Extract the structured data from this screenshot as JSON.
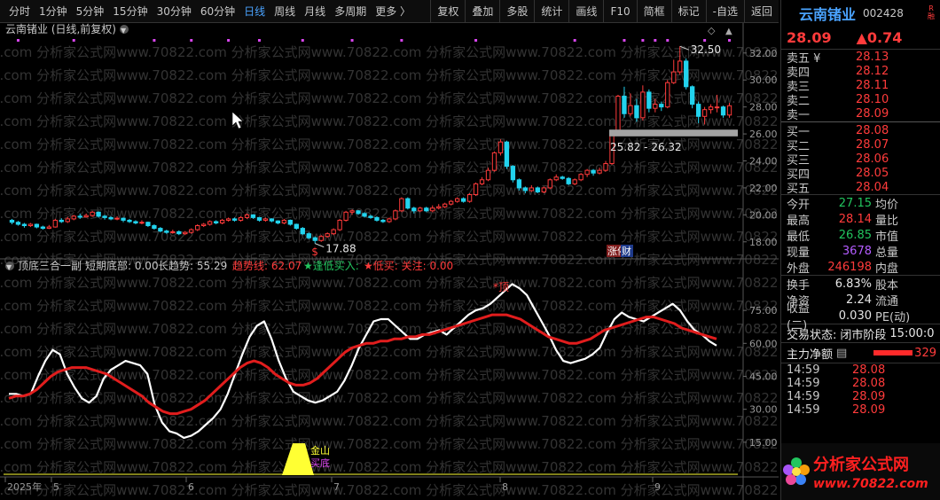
{
  "toolbar": {
    "timeframes": [
      {
        "label": "分时",
        "active": false
      },
      {
        "label": "1分钟",
        "active": false
      },
      {
        "label": "5分钟",
        "active": false
      },
      {
        "label": "15分钟",
        "active": false
      },
      {
        "label": "30分钟",
        "active": false
      },
      {
        "label": "60分钟",
        "active": false
      },
      {
        "label": "日线",
        "active": true
      },
      {
        "label": "周线",
        "active": false
      },
      {
        "label": "月线",
        "active": false
      },
      {
        "label": "多周期",
        "active": false
      },
      {
        "label": "更多 〉",
        "active": false
      }
    ],
    "tools": [
      "复权",
      "叠加",
      "多股",
      "统计",
      "画线",
      "F10",
      "简框",
      "标记",
      "-自选",
      "返回"
    ]
  },
  "main_chart": {
    "title": "云南锗业 (日线,前复权)",
    "y_ticks": [
      "32.00",
      "30.00",
      "28.00",
      "26.00",
      "24.00",
      "22.00",
      "20.00",
      "18.00"
    ],
    "labels": {
      "high": "32.50",
      "low": "17.88",
      "range": "25.82 - 26.32",
      "badge": "涨停",
      "badge2": "财",
      "dollar": "$"
    },
    "colors": {
      "up": "#ff3b3b",
      "down": "#22d3ee",
      "marker": "#d946ef",
      "band": "#a3a3a3"
    }
  },
  "chart_data": [
    {
      "type": "candlestick",
      "title": "云南锗业 (日线,前复权)",
      "ylim": [
        17,
        33.3
      ],
      "annotations": [
        {
          "text": "32.50",
          "at": "high"
        },
        {
          "text": "17.88",
          "at": "low"
        },
        {
          "text": "25.82 - 26.32",
          "at": "band"
        }
      ],
      "candles": [
        [
          19.6,
          19.45,
          19.7,
          19.3
        ],
        [
          19.45,
          19.3,
          19.55,
          19.2
        ],
        [
          19.3,
          19.2,
          19.4,
          19.05
        ],
        [
          19.2,
          19.3,
          19.4,
          19.1
        ],
        [
          19.3,
          19.1,
          19.35,
          19.0
        ],
        [
          19.1,
          19.0,
          19.2,
          18.9
        ],
        [
          19.0,
          19.1,
          19.25,
          18.95
        ],
        [
          19.1,
          19.6,
          19.7,
          19.05
        ],
        [
          19.6,
          19.5,
          19.75,
          19.4
        ],
        [
          19.5,
          19.7,
          19.85,
          19.4
        ],
        [
          19.7,
          19.9,
          20.0,
          19.6
        ],
        [
          19.9,
          19.85,
          20.1,
          19.7
        ],
        [
          19.85,
          19.95,
          20.1,
          19.8
        ],
        [
          19.95,
          20.2,
          20.3,
          19.85
        ],
        [
          20.2,
          19.9,
          20.25,
          19.8
        ],
        [
          19.9,
          19.8,
          20.0,
          19.65
        ],
        [
          19.8,
          19.7,
          19.9,
          19.6
        ],
        [
          19.7,
          19.75,
          19.9,
          19.6
        ],
        [
          19.75,
          19.6,
          19.8,
          19.45
        ],
        [
          19.6,
          19.5,
          19.7,
          19.4
        ],
        [
          19.5,
          19.4,
          19.6,
          19.3
        ],
        [
          19.4,
          19.45,
          19.6,
          19.3
        ],
        [
          19.45,
          19.2,
          19.5,
          19.1
        ],
        [
          19.2,
          19.0,
          19.3,
          18.9
        ],
        [
          19.0,
          18.8,
          19.1,
          18.7
        ],
        [
          18.8,
          18.7,
          18.9,
          18.6
        ],
        [
          18.7,
          18.75,
          18.9,
          18.6
        ],
        [
          18.75,
          18.6,
          18.85,
          18.5
        ],
        [
          18.6,
          18.7,
          18.8,
          18.5
        ],
        [
          18.7,
          18.9,
          19.0,
          18.6
        ],
        [
          18.9,
          19.2,
          19.3,
          18.8
        ],
        [
          19.2,
          19.3,
          19.4,
          19.1
        ],
        [
          19.3,
          19.5,
          19.6,
          19.2
        ],
        [
          19.5,
          19.4,
          19.6,
          19.3
        ],
        [
          19.4,
          19.6,
          19.7,
          19.3
        ],
        [
          19.6,
          19.7,
          19.8,
          19.5
        ],
        [
          19.7,
          19.6,
          19.8,
          19.5
        ],
        [
          19.6,
          19.8,
          19.9,
          19.5
        ],
        [
          19.8,
          20.0,
          20.1,
          19.7
        ],
        [
          20.0,
          19.8,
          20.05,
          19.7
        ],
        [
          19.8,
          19.6,
          19.85,
          19.5
        ],
        [
          19.6,
          19.7,
          19.8,
          19.5
        ],
        [
          19.7,
          19.55,
          19.75,
          19.45
        ],
        [
          19.55,
          19.4,
          19.6,
          19.3
        ],
        [
          19.4,
          19.6,
          19.7,
          19.3
        ],
        [
          19.6,
          19.3,
          19.65,
          19.2
        ],
        [
          19.3,
          19.0,
          19.35,
          18.9
        ],
        [
          19.0,
          18.6,
          19.1,
          18.5
        ],
        [
          18.6,
          18.3,
          18.7,
          18.2
        ],
        [
          18.3,
          18.1,
          18.4,
          17.88
        ],
        [
          18.1,
          18.4,
          18.5,
          18.0
        ],
        [
          18.4,
          18.6,
          18.7,
          18.3
        ],
        [
          18.6,
          18.9,
          19.0,
          18.5
        ],
        [
          18.9,
          19.6,
          19.7,
          18.8
        ],
        [
          19.6,
          20.2,
          20.3,
          19.5
        ],
        [
          20.2,
          20.3,
          20.4,
          20.0
        ],
        [
          20.3,
          20.1,
          20.35,
          20.0
        ],
        [
          20.1,
          19.9,
          20.2,
          19.8
        ],
        [
          19.9,
          19.8,
          20.0,
          19.7
        ],
        [
          19.8,
          19.6,
          19.9,
          19.5
        ],
        [
          19.6,
          19.5,
          19.7,
          19.4
        ],
        [
          19.5,
          19.7,
          19.8,
          19.4
        ],
        [
          19.7,
          20.3,
          20.4,
          19.6
        ],
        [
          20.3,
          21.2,
          21.3,
          20.2
        ],
        [
          21.2,
          20.5,
          21.3,
          20.4
        ],
        [
          20.5,
          20.3,
          20.6,
          20.1
        ],
        [
          20.3,
          20.5,
          20.6,
          20.2
        ],
        [
          20.5,
          20.3,
          20.6,
          20.2
        ],
        [
          20.3,
          20.5,
          20.7,
          20.2
        ],
        [
          20.5,
          20.6,
          20.8,
          20.4
        ],
        [
          20.6,
          20.8,
          20.9,
          20.5
        ],
        [
          20.8,
          21.0,
          21.1,
          20.7
        ],
        [
          21.0,
          21.2,
          21.3,
          20.9
        ],
        [
          21.2,
          21.0,
          21.3,
          20.9
        ],
        [
          21.0,
          21.5,
          21.6,
          20.9
        ],
        [
          21.5,
          22.3,
          22.4,
          21.4
        ],
        [
          22.3,
          22.6,
          22.8,
          22.2
        ],
        [
          22.6,
          23.3,
          23.5,
          22.5
        ],
        [
          23.3,
          24.6,
          24.7,
          23.2
        ],
        [
          24.6,
          25.4,
          25.6,
          24.4
        ],
        [
          25.4,
          23.6,
          25.5,
          23.4
        ],
        [
          23.6,
          22.6,
          23.7,
          22.4
        ],
        [
          22.6,
          22.0,
          22.7,
          21.8
        ],
        [
          22.0,
          21.8,
          22.1,
          21.6
        ],
        [
          21.8,
          22.0,
          22.2,
          21.7
        ],
        [
          22.0,
          21.7,
          22.1,
          21.6
        ],
        [
          21.7,
          22.0,
          22.1,
          21.6
        ],
        [
          22.0,
          22.6,
          22.7,
          21.9
        ],
        [
          22.6,
          22.8,
          23.0,
          22.5
        ],
        [
          22.8,
          22.7,
          22.9,
          22.6
        ],
        [
          22.7,
          22.3,
          22.8,
          22.2
        ],
        [
          22.3,
          22.6,
          22.7,
          22.2
        ],
        [
          22.6,
          23.0,
          23.1,
          22.5
        ],
        [
          23.0,
          23.3,
          23.4,
          22.8
        ],
        [
          23.3,
          23.1,
          23.4,
          22.9
        ],
        [
          23.1,
          23.3,
          23.5,
          23.0
        ],
        [
          23.3,
          23.8,
          24.0,
          23.2
        ],
        [
          23.8,
          26.2,
          26.3,
          23.7
        ],
        [
          26.2,
          28.8,
          28.9,
          26.2
        ],
        [
          28.8,
          27.5,
          29.5,
          27.2
        ],
        [
          27.5,
          28.1,
          29.0,
          27.3
        ],
        [
          28.1,
          27.2,
          28.6,
          26.9
        ],
        [
          27.2,
          29.1,
          29.6,
          27.0
        ],
        [
          29.1,
          27.9,
          29.3,
          27.6
        ],
        [
          27.9,
          28.2,
          28.6,
          27.6
        ],
        [
          28.2,
          28.0,
          28.4,
          27.7
        ],
        [
          28.0,
          29.8,
          30.0,
          27.9
        ],
        [
          29.8,
          30.6,
          31.5,
          29.7
        ],
        [
          30.6,
          31.4,
          32.5,
          30.4
        ],
        [
          31.4,
          29.5,
          31.6,
          29.3
        ],
        [
          29.5,
          28.2,
          29.6,
          27.9
        ],
        [
          28.2,
          27.3,
          28.4,
          26.8
        ],
        [
          27.3,
          27.8,
          28.0,
          26.7
        ],
        [
          27.8,
          28.0,
          28.2,
          27.5
        ],
        [
          28.0,
          28.0,
          28.9,
          27.6
        ],
        [
          28.0,
          27.4,
          28.1,
          27.2
        ],
        [
          27.4,
          28.09,
          28.3,
          27.2
        ]
      ]
    },
    {
      "type": "line",
      "title": "顶底三合一副",
      "ylim": [
        0,
        92
      ],
      "y_ticks": [
        "75.00",
        "60.00",
        "45.00",
        "30.00",
        "15.00"
      ],
      "x_tick_labels": [
        "2025年",
        "5",
        "6",
        "7",
        "8",
        "9"
      ],
      "legend": [
        {
          "text": "短期底部: 0.00",
          "color": "#c8c8c8"
        },
        {
          "text": "长趋势: 55.29",
          "color": "#c8c8c8"
        },
        {
          "text": "趋势线: 62.07",
          "color": "#ff3b3b"
        },
        {
          "text": "★逢低买入:",
          "color": "#22c55e"
        },
        {
          "text": "★低买: 关注: 0.00",
          "color": "#ff3b3b"
        }
      ],
      "series": [
        {
          "name": "短期底部",
          "color": "#ffffff",
          "values": [
            37,
            37,
            36,
            37,
            45,
            52,
            57,
            55,
            46,
            40,
            35,
            33,
            36,
            44,
            48,
            50,
            52,
            51,
            50,
            46,
            32,
            24,
            20,
            19,
            17,
            18,
            20,
            23,
            26,
            30,
            37,
            46,
            55,
            63,
            68,
            70,
            62,
            52,
            44,
            38,
            36,
            34,
            33,
            34,
            36,
            38,
            43,
            50,
            58,
            64,
            70,
            71,
            71,
            68,
            65,
            62,
            62,
            64,
            65,
            66,
            64,
            67,
            70,
            73,
            75,
            76,
            78,
            81,
            84,
            87,
            85,
            82,
            76,
            70,
            64,
            57,
            52,
            51,
            52,
            53,
            55,
            58,
            65,
            71,
            74,
            72,
            71,
            70,
            72,
            74,
            76,
            78,
            75,
            70,
            66,
            64,
            61,
            59
          ]
        },
        {
          "name": "趋势线",
          "color": "#e11d1d",
          "values": [
            35,
            36,
            36,
            37,
            39,
            42,
            45,
            47,
            48,
            49,
            49,
            49,
            48,
            47,
            46,
            44,
            42,
            40,
            38,
            36,
            33,
            31,
            29,
            28,
            28,
            29,
            30,
            32,
            34,
            37,
            40,
            43,
            46,
            49,
            51,
            52,
            51,
            49,
            46,
            44,
            42,
            41,
            41,
            42,
            44,
            47,
            50,
            53,
            56,
            58,
            59,
            60,
            60,
            61,
            61,
            62,
            62,
            63,
            63,
            64,
            64,
            65,
            66,
            67,
            68,
            69,
            70,
            71,
            72,
            73,
            73,
            73,
            72,
            71,
            69,
            67,
            65,
            63,
            62,
            61,
            60,
            60,
            61,
            62,
            64,
            66,
            67,
            68,
            69,
            70,
            71,
            72,
            72,
            71,
            70,
            69,
            67,
            66,
            65,
            64,
            63,
            62
          ]
        }
      ],
      "annotations": [
        {
          "text": "*顶",
          "color": "#ff3b3b"
        },
        {
          "text": "金山",
          "color": "#ffff33"
        },
        {
          "text": "买底",
          "color": "#d946ef"
        }
      ]
    }
  ],
  "rpanel": {
    "stock_name": "云南锗业",
    "stock_code": "002428",
    "tags": [
      "R",
      "融"
    ],
    "last_price": "28.09",
    "change": "▲0.74",
    "order_book": {
      "asks": [
        {
          "label": "卖五 ¥",
          "price": "28.13"
        },
        {
          "label": "卖四",
          "price": "28.12"
        },
        {
          "label": "卖三",
          "price": "28.11"
        },
        {
          "label": "卖二",
          "price": "28.10"
        },
        {
          "label": "卖一",
          "price": "28.09"
        }
      ],
      "bids": [
        {
          "label": "买一",
          "price": "28.08"
        },
        {
          "label": "买二",
          "price": "28.07"
        },
        {
          "label": "买三",
          "price": "28.06"
        },
        {
          "label": "买四",
          "price": "28.05"
        },
        {
          "label": "买五",
          "price": "28.04"
        }
      ]
    },
    "quote": [
      {
        "l1": "今开",
        "v1": "27.15",
        "c1": "green",
        "l2": "均价"
      },
      {
        "l1": "最高",
        "v1": "28.14",
        "c1": "red",
        "l2": "量比"
      },
      {
        "l1": "最低",
        "v1": "26.85",
        "c1": "green",
        "l2": "市值"
      },
      {
        "l1": "现量",
        "v1": "3678",
        "c1": "purple",
        "l2": "总量"
      },
      {
        "l1": "外盘",
        "v1": "246198",
        "c1": "red",
        "l2": "内盘"
      }
    ],
    "quote2": [
      {
        "l1": "换手",
        "v1": "6.83%",
        "l2": "股本"
      },
      {
        "l1": "净资",
        "v1": "2.24",
        "l2": "流通"
      },
      {
        "l1": "收益(二)",
        "v1": "0.030",
        "l2": "PE(动)"
      }
    ],
    "trade_state": {
      "label": "交易状态:",
      "value": "闭市阶段",
      "time": "15:00:0"
    },
    "net_flow": {
      "label": "主力净额",
      "value": "329"
    },
    "ticks": [
      {
        "time": "14:59",
        "price": "28.08"
      },
      {
        "time": "14:59",
        "price": "28.08"
      },
      {
        "time": "14:59",
        "price": "28.09"
      },
      {
        "time": "14:59",
        "price": "28.09"
      }
    ],
    "logo": {
      "title": "分析家公式网",
      "url": "www.70822.com"
    }
  }
}
